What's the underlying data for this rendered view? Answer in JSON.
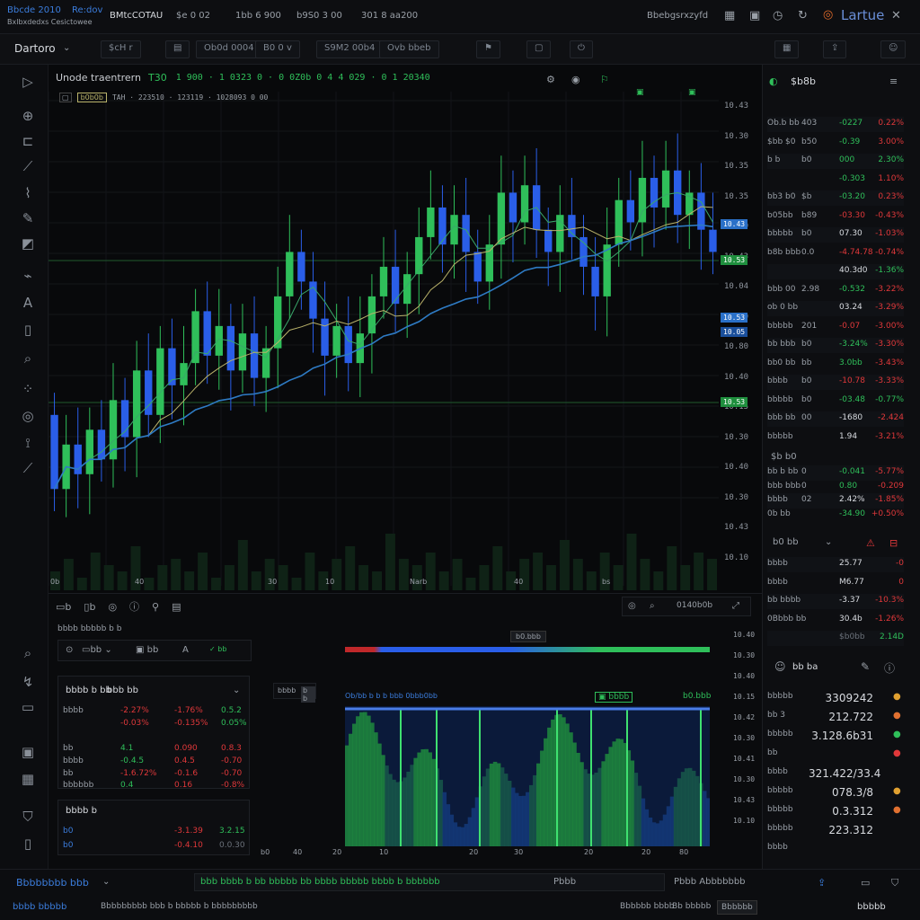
{
  "topbar": {
    "brand_line1": "Bbcde 2010",
    "brand_tag": "Re:dov",
    "brand_line2": "Bxlbxdedxs Cesictowee",
    "symbol": "BMtcCOTAU",
    "stat1": "$e 0 02",
    "stat2": "1bb 6 900",
    "stat3": "b9S0 3 00",
    "stat4": "301 8 aa200",
    "user": "Bbebgsrxzyfd",
    "app_name": "Lartue"
  },
  "toolbar": {
    "workspace": "Dartoro",
    "btn1": "$cH r",
    "btn2": "Ob0d 0004",
    "btn3": "B0 0 v",
    "btn4": "S9M2 00b4",
    "btn5": "Ovb bbeb"
  },
  "chart_header": {
    "title": "Unode traentrern",
    "tf": "T30",
    "ohlc": "1 900 · 1 0323 0 · 0 0Z0b 0 4 4 029 · 0 1 20340",
    "sub_tag": "b0b0b",
    "sub_text": "TAH · 223510 · 123119 · 1028093 0 00"
  },
  "price_axis": [
    "10.43",
    "10.30",
    "10.35",
    "10.35",
    "10.30",
    "10.43",
    "10.04",
    "10.30",
    "10.80",
    "10.40",
    "10.15",
    "10.30",
    "10.40",
    "10.30",
    "10.43",
    "10.10"
  ],
  "price_tags": [
    {
      "text": "10.43",
      "color": "#2a70c8"
    },
    {
      "text": "10.53",
      "color": "#1f8f3e"
    },
    {
      "text": "10.53",
      "color": "#2a70c8"
    },
    {
      "text": "10.05",
      "color": "#1a4f9c"
    },
    {
      "text": "10.53",
      "color": "#1f8f3e"
    }
  ],
  "time_axis": [
    "0b",
    "40",
    "30",
    "10",
    "Narb",
    "40",
    "bs"
  ],
  "chart_data": {
    "type": "candlestick",
    "candles": [
      {
        "o": 10.22,
        "c": 10.12
      },
      {
        "o": 10.12,
        "c": 10.18
      },
      {
        "o": 10.18,
        "c": 10.14
      },
      {
        "o": 10.14,
        "c": 10.2
      },
      {
        "o": 10.2,
        "c": 10.16
      },
      {
        "o": 10.16,
        "c": 10.24
      },
      {
        "o": 10.24,
        "c": 10.19
      },
      {
        "o": 10.19,
        "c": 10.28
      },
      {
        "o": 10.28,
        "c": 10.22
      },
      {
        "o": 10.22,
        "c": 10.31
      },
      {
        "o": 10.31,
        "c": 10.26
      },
      {
        "o": 10.26,
        "c": 10.29
      },
      {
        "o": 10.29,
        "c": 10.36
      },
      {
        "o": 10.36,
        "c": 10.3
      },
      {
        "o": 10.3,
        "c": 10.34
      },
      {
        "o": 10.34,
        "c": 10.28
      },
      {
        "o": 10.28,
        "c": 10.33
      },
      {
        "o": 10.33,
        "c": 10.27
      },
      {
        "o": 10.27,
        "c": 10.31
      },
      {
        "o": 10.31,
        "c": 10.38
      },
      {
        "o": 10.38,
        "c": 10.44
      },
      {
        "o": 10.44,
        "c": 10.4
      },
      {
        "o": 10.4,
        "c": 10.35
      },
      {
        "o": 10.35,
        "c": 10.3
      },
      {
        "o": 10.3,
        "c": 10.34
      },
      {
        "o": 10.34,
        "c": 10.29
      },
      {
        "o": 10.29,
        "c": 10.33
      },
      {
        "o": 10.33,
        "c": 10.38
      },
      {
        "o": 10.38,
        "c": 10.42
      },
      {
        "o": 10.42,
        "c": 10.37
      },
      {
        "o": 10.37,
        "c": 10.41
      },
      {
        "o": 10.41,
        "c": 10.46
      },
      {
        "o": 10.46,
        "c": 10.5
      },
      {
        "o": 10.5,
        "c": 10.45
      },
      {
        "o": 10.45,
        "c": 10.49
      },
      {
        "o": 10.49,
        "c": 10.44
      },
      {
        "o": 10.44,
        "c": 10.4
      },
      {
        "o": 10.4,
        "c": 10.45
      },
      {
        "o": 10.45,
        "c": 10.52
      },
      {
        "o": 10.52,
        "c": 10.48
      },
      {
        "o": 10.48,
        "c": 10.53
      },
      {
        "o": 10.53,
        "c": 10.47
      },
      {
        "o": 10.47,
        "c": 10.44
      },
      {
        "o": 10.44,
        "c": 10.49
      },
      {
        "o": 10.49,
        "c": 10.46
      },
      {
        "o": 10.46,
        "c": 10.42
      },
      {
        "o": 10.42,
        "c": 10.38
      },
      {
        "o": 10.38,
        "c": 10.45
      },
      {
        "o": 10.45,
        "c": 10.51
      },
      {
        "o": 10.51,
        "c": 10.48
      },
      {
        "o": 10.48,
        "c": 10.54
      },
      {
        "o": 10.54,
        "c": 10.5
      },
      {
        "o": 10.5,
        "c": 10.55
      },
      {
        "o": 10.55,
        "c": 10.49
      },
      {
        "o": 10.49,
        "c": 10.52
      },
      {
        "o": 10.52,
        "c": 10.47
      },
      {
        "o": 10.47,
        "c": 10.44
      }
    ],
    "ylim": [
      10.05,
      10.62
    ]
  },
  "volume_data": [
    3,
    5,
    2,
    6,
    4,
    3,
    7,
    2,
    4,
    5,
    3,
    6,
    2,
    4,
    8,
    3,
    5,
    4,
    2,
    6,
    3,
    5,
    7,
    4,
    3,
    9,
    5,
    4,
    6,
    3,
    5,
    2,
    4,
    7,
    3,
    5,
    6,
    4,
    8,
    5,
    3,
    6,
    4,
    9,
    5,
    3,
    7,
    4,
    6,
    5
  ],
  "watchlist": {
    "header": "$b8b",
    "rows": [
      {
        "a": "Ob.b bb",
        "b": "403",
        "c": "-0227",
        "d": "0.22%",
        "cc": "up",
        "dc": "dn"
      },
      {
        "a": "$bb $0",
        "b": "b50",
        "c": "-0.39",
        "d": "3.00%",
        "cc": "up",
        "dc": "dn"
      },
      {
        "a": "b b",
        "b": "b0",
        "c": "000",
        "d": "2.30%",
        "cc": "up",
        "dc": "up"
      },
      {
        "a": "",
        "b": "",
        "c": "-0.303",
        "d": "1.10%",
        "cc": "up",
        "dc": "dn"
      },
      {
        "a": "bb3 b0",
        "b": "$b",
        "c": "-03.20",
        "d": "0.23%",
        "cc": "up",
        "dc": "dn"
      },
      {
        "a": "b05bb",
        "b": "b89",
        "c": "-03.30",
        "d": "-0.43%",
        "cc": "dn",
        "dc": "dn"
      },
      {
        "a": "bbbbb",
        "b": "b0",
        "c": "07.30",
        "d": "-1.03%",
        "cc": "bright",
        "dc": "dn"
      },
      {
        "a": "b8b bbb",
        "b": "0.0",
        "c": "-4.74.78",
        "d": "-0.74%",
        "cc": "dn",
        "dc": "dn"
      },
      {
        "a": "",
        "b": "",
        "c": "40.3d0",
        "d": "-1.36%",
        "cc": "bright",
        "dc": "up"
      },
      {
        "a": "bbb 00",
        "b": "2.98",
        "c": "-0.532",
        "d": "-3.22%",
        "cc": "up",
        "dc": "dn"
      },
      {
        "a": "ob 0 bb",
        "b": "",
        "c": "03.24",
        "d": "-3.29%",
        "cc": "bright",
        "dc": "dn"
      },
      {
        "a": "bbbbb",
        "b": "201",
        "c": "-0.07",
        "d": "-3.00%",
        "cc": "dn",
        "dc": "dn"
      },
      {
        "a": "bb bbb",
        "b": "b0",
        "c": "-3.24%",
        "d": "-3.30%",
        "cc": "up",
        "dc": "dn"
      },
      {
        "a": "bb0 bb",
        "b": "bb",
        "c": "3.0bb",
        "d": "-3.43%",
        "cc": "up",
        "dc": "dn"
      },
      {
        "a": "bbbb",
        "b": "b0",
        "c": "-10.78",
        "d": "-3.33%",
        "cc": "dn",
        "dc": "dn"
      },
      {
        "a": "bbbbb",
        "b": "b0",
        "c": "-03.48",
        "d": "-0.77%",
        "cc": "up",
        "dc": "up"
      },
      {
        "a": "bbb bb",
        "b": "00",
        "c": "-1680",
        "d": "-2.424",
        "cc": "bright",
        "dc": "dn"
      },
      {
        "a": "bbbbb",
        "b": "",
        "c": "1.94",
        "d": "-3.21%",
        "cc": "bright",
        "dc": "dn"
      }
    ],
    "section2": "$b b0",
    "rows2": [
      {
        "a": "bb b bb",
        "b": "0",
        "c": "-0.041",
        "d": "-5.77%",
        "cc": "up",
        "dc": "dn"
      },
      {
        "a": "bbb bbb",
        "b": "0",
        "c": "0.80",
        "d": "-0.209",
        "cc": "up",
        "dc": "dn"
      },
      {
        "a": "bbbb",
        "b": "02",
        "c": "2.42%",
        "d": "-1.85%",
        "cc": "bright",
        "dc": "dn"
      },
      {
        "a": "0b bb",
        "b": "",
        "c": "-34.90",
        "d": "+0.50%",
        "cc": "up",
        "dc": "dn"
      }
    ],
    "section3": "b0 bb",
    "rows3": [
      {
        "a": "bbbb",
        "c": "25.77",
        "d": "-0",
        "cc": "bright",
        "dc": "dn"
      },
      {
        "a": "bbbb",
        "c": "M6.77",
        "d": "0",
        "cc": "bright",
        "dc": "dn"
      },
      {
        "a": "bb bbbb",
        "c": "-3.37",
        "d": "-10.3%",
        "cc": "bright",
        "dc": "dn"
      },
      {
        "a": "0Bbbb bb",
        "c": "30.4b",
        "d": "-1.26%",
        "cc": "bright",
        "dc": "dn"
      },
      {
        "a": "",
        "c": "$b0bb",
        "d": "2.14D",
        "cc": "dim",
        "dc": "up"
      }
    ],
    "section4": "bb ba",
    "big": [
      {
        "a": "bbbbb",
        "v": "3309242",
        "dot": "#e0a030"
      },
      {
        "a": "bb 3",
        "v": "212.722",
        "dot": "#e07030"
      },
      {
        "a": "bbbbb",
        "v": "3.128.6b31",
        "dot": "#2fbf5a"
      },
      {
        "a": "bb",
        "v": "",
        "dot": "#e0383a"
      },
      {
        "a": "bbbb",
        "v": "321.422/33.4",
        "dot": ""
      },
      {
        "a": "bbbbb",
        "v": "078.3/8",
        "dot": "#e0a030"
      },
      {
        "a": "bbbbb",
        "v": "0.3.312",
        "dot": "#e07030"
      },
      {
        "a": "bbbbb",
        "v": "223.312",
        "dot": ""
      },
      {
        "a": "bbbb",
        "v": "",
        "dot": ""
      }
    ]
  },
  "bottom": {
    "tabs_label": "bbbb bbbbb b b",
    "left_header": "bbbb b bb",
    "left_header2": "bbb bb",
    "tbl": [
      {
        "a": "bbbb",
        "b": "-2.27%",
        "c": "-1.76%",
        "d": "0.5.2",
        "bc": "dn",
        "cc": "dn",
        "dc": "up"
      },
      {
        "a": "",
        "b": "-0.03%",
        "c": "-0.135%",
        "d": "0.05%",
        "bc": "dn",
        "cc": "dn",
        "dc": "up"
      },
      {
        "a": "bb",
        "b": "4.1",
        "c": "0.090",
        "d": "0.8.3",
        "bc": "up",
        "cc": "dn",
        "dc": "dn"
      },
      {
        "a": "bbbb",
        "b": "-0.4.5",
        "c": "0.4.5",
        "d": "-0.70",
        "bc": "up",
        "cc": "dn",
        "dc": "dn"
      },
      {
        "a": "bb",
        "b": "-1.6.72%",
        "c": "-0.1.6",
        "d": "-0.70",
        "bc": "dn",
        "cc": "dn",
        "dc": "dn"
      },
      {
        "a": "bbbbbb",
        "b": "0.4",
        "c": "0.16",
        "d": "-0.8%",
        "bc": "up",
        "cc": "dn",
        "dc": "dn"
      }
    ],
    "sub_header": "bbbb b",
    "sub_rows": [
      {
        "a": "b0",
        "b": "-3.1.39",
        "c": "3.2.15",
        "bc": "dn",
        "cc": "up"
      },
      {
        "a": "b0",
        "b": "-0.4.10",
        "c": "0.0.30",
        "bc": "dn",
        "cc": "dim"
      }
    ],
    "heat_title": "Ob/bb b b b bbb 0bbb0bb",
    "heat_label": "b0.bbb",
    "heat_tags": [
      "bbbb",
      "b b"
    ],
    "heat_time": [
      "b0",
      "40",
      "20",
      "10",
      "20",
      "30",
      "20",
      "20",
      "80"
    ],
    "ind_axis": [
      "10.40",
      "10.30",
      "10.40",
      "10.15",
      "10.42",
      "10.30",
      "10.41",
      "10.30",
      "10.43",
      "10.10"
    ]
  },
  "statusbar": {
    "left": "Bbbbbbbb bbb",
    "center_note": "bbb bbbb b bb bbbbb bb bbbb bbbbb bbbb b bbbbbb",
    "right1": "Pbbb",
    "right2": "Pbbb Abbbbbbb",
    "bottom_left": "bbbb bbbbb",
    "bottom_mid": "Bbbbbbbbb bbb b bbbbb b bbbbbbbbb",
    "bottom_r1": "Bbbbbb bbbb",
    "bottom_r2": "Bb bbbbb",
    "bottom_r3": "Bbbbbb",
    "bottom_r4": "bbbbb"
  },
  "colors": {
    "up": "#2fbf5a",
    "down_candle": "#2a5ee8",
    "ma1": "#2e7bc4",
    "ma2": "#b9b26a",
    "ma3": "#3aa76a"
  }
}
